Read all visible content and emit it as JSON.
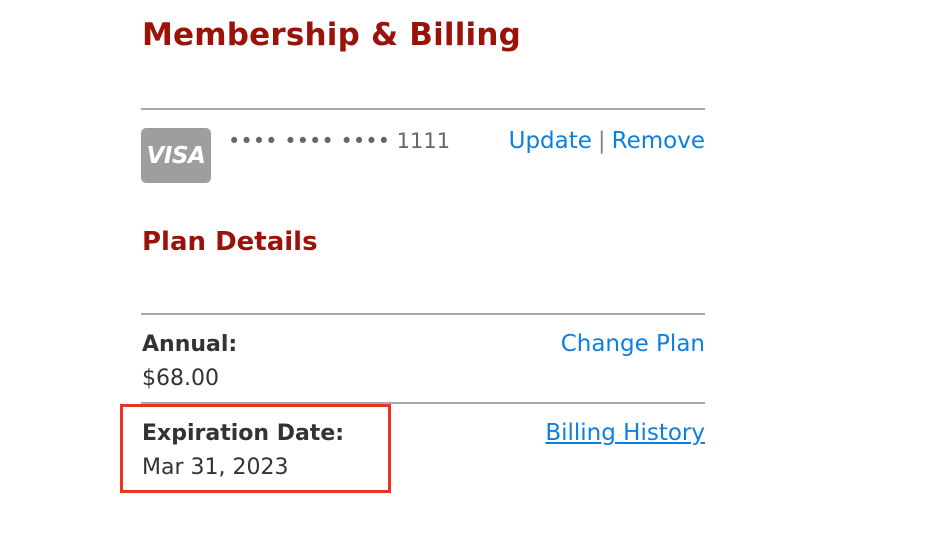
{
  "page": {
    "title": "Membership & Billing"
  },
  "payment": {
    "card_brand": "VISA",
    "card_number_masked": "•••• •••• •••• 1111",
    "update_label": "Update",
    "separator": "|",
    "remove_label": "Remove"
  },
  "plan": {
    "section_title": "Plan Details",
    "plan_label": "Annual:",
    "plan_price": "$68.00",
    "change_plan_label": "Change Plan",
    "expiration_label": "Expiration Date:",
    "expiration_value": "Mar 31, 2023",
    "billing_history_label": "Billing History"
  },
  "colors": {
    "heading": "#9b1209",
    "link": "#0d7fe0",
    "highlight": "#e8351f",
    "card_logo_bg": "#9e9e9e"
  },
  "icons": {
    "card_logo": "visa-card-icon"
  }
}
